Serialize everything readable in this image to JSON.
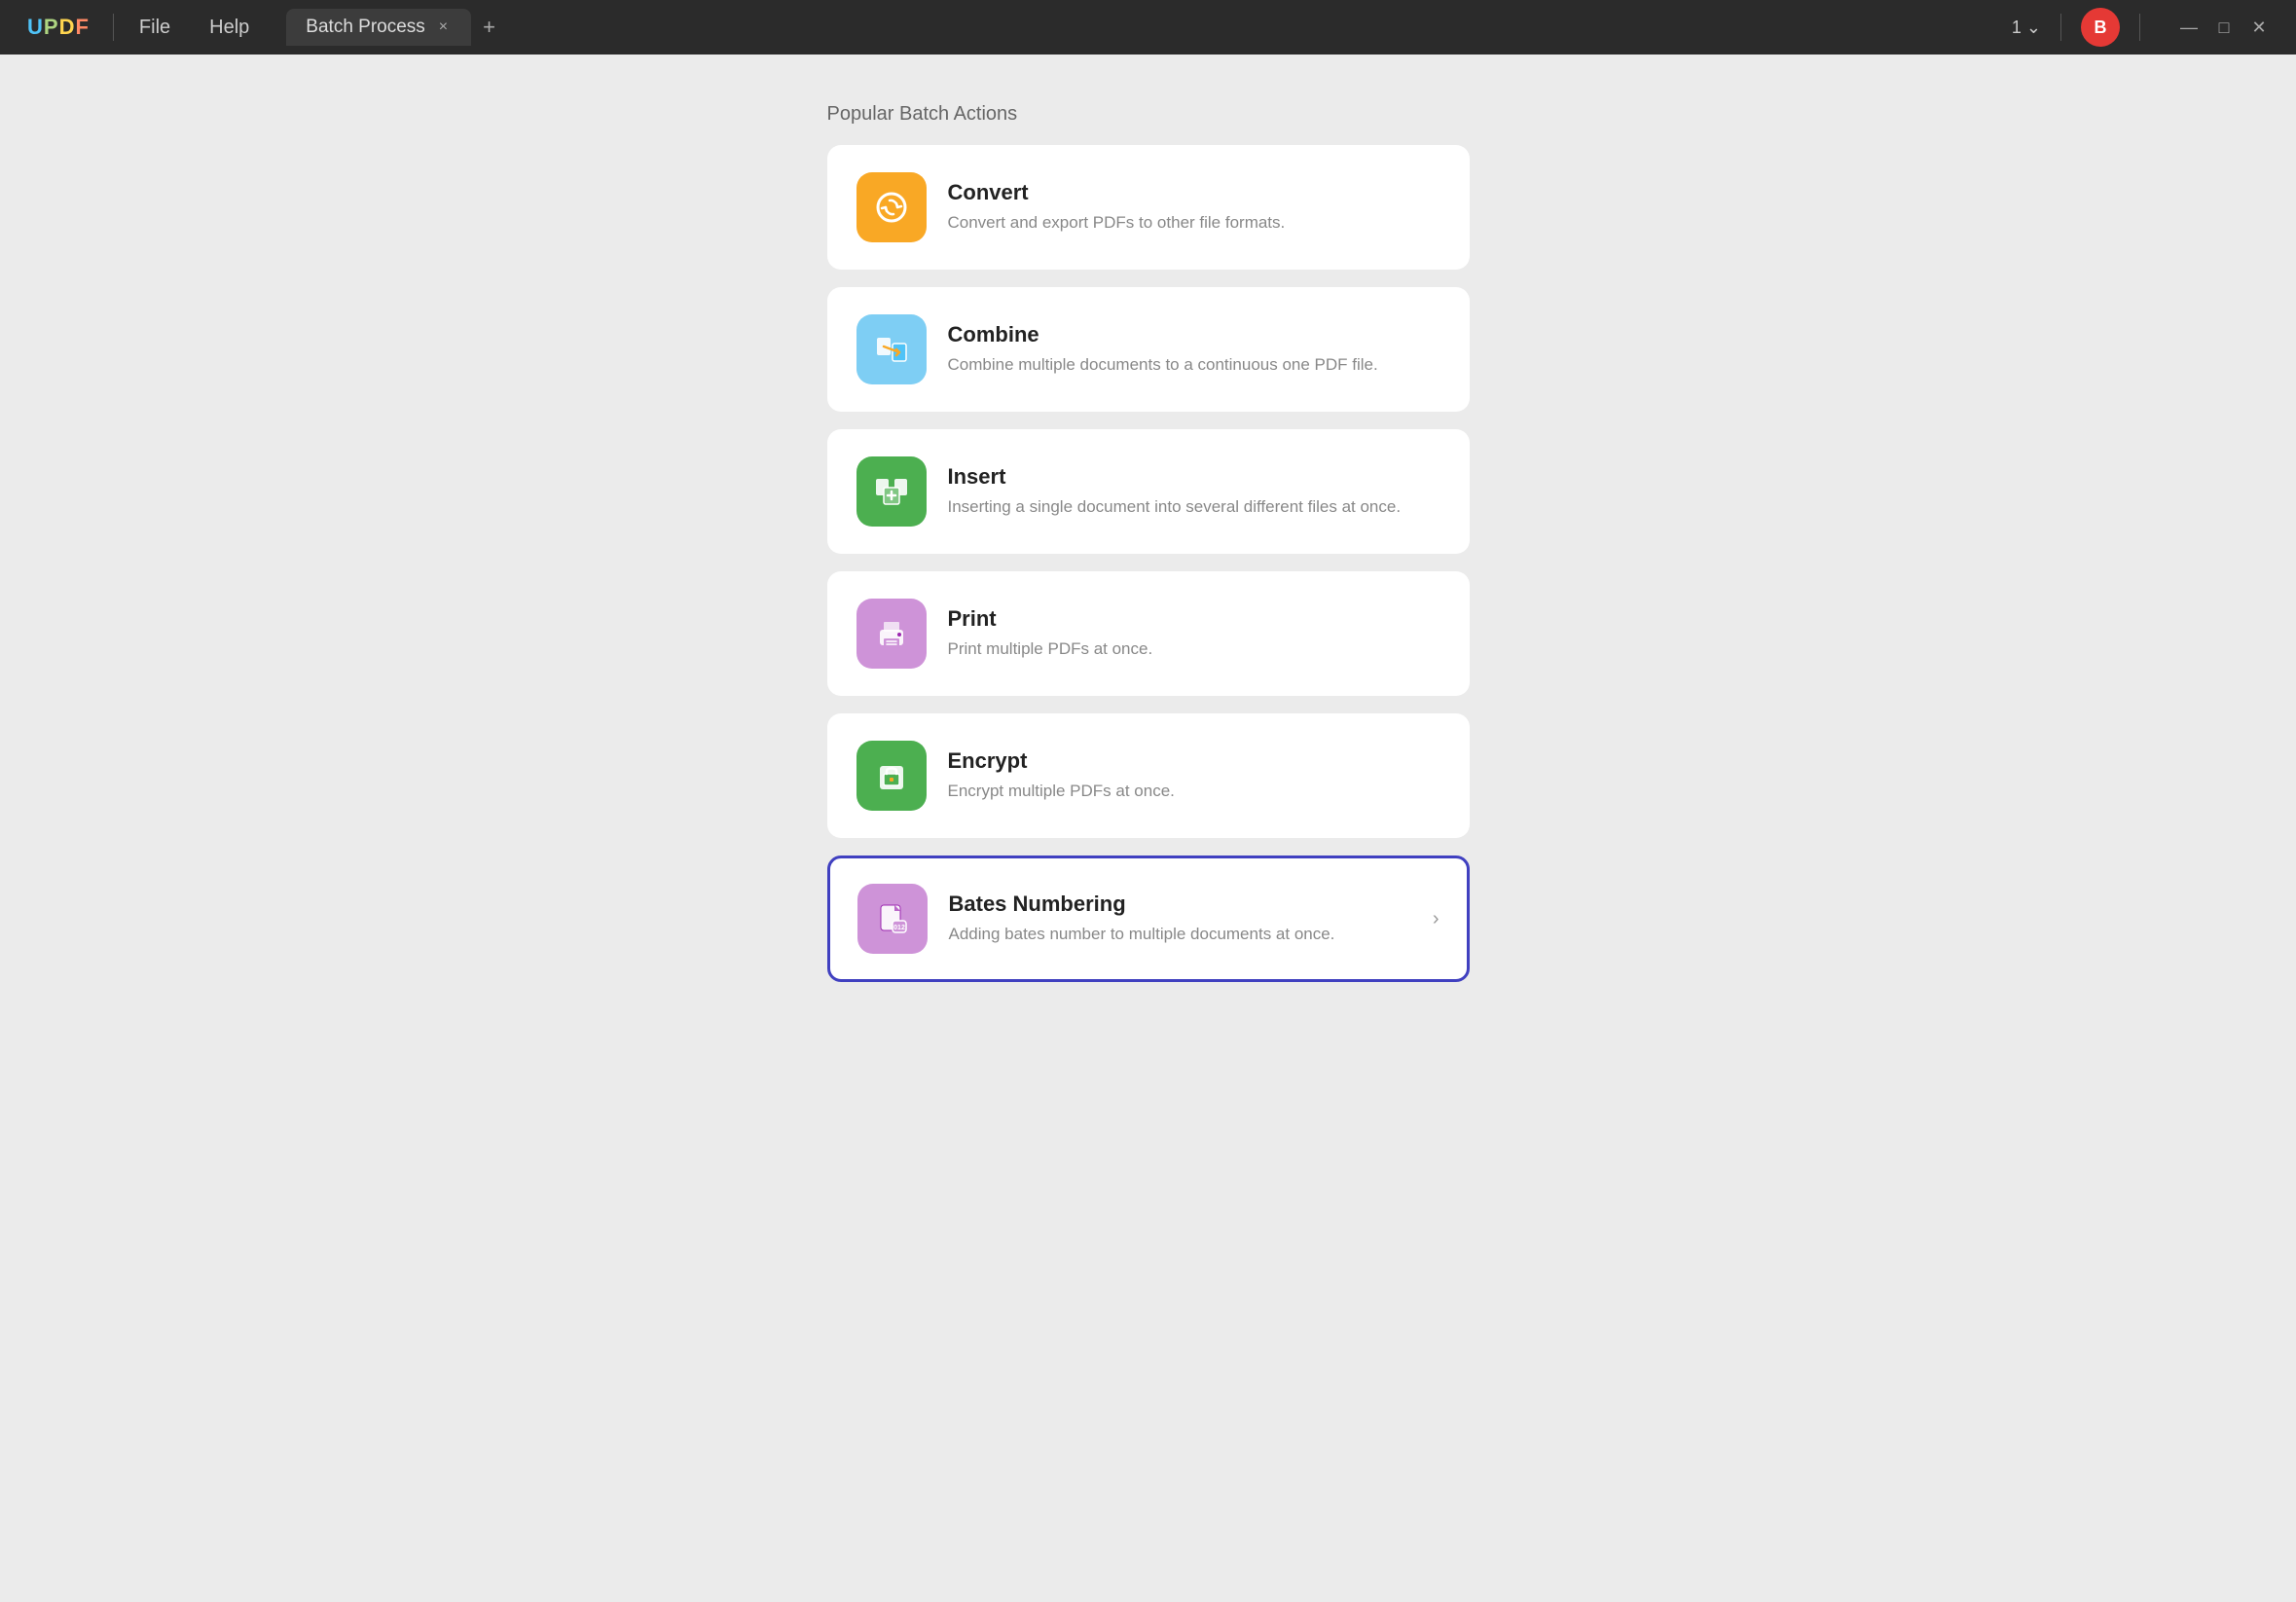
{
  "app": {
    "logo": "UPDF",
    "logo_colors": [
      "U",
      "P",
      "D",
      "F"
    ]
  },
  "titlebar": {
    "menu_items": [
      "File",
      "Help"
    ],
    "tab_title": "Batch Process",
    "tab_close_symbol": "×",
    "tab_new_symbol": "+",
    "window_count": "1",
    "window_count_arrow": "⌄",
    "user_initial": "B",
    "minimize": "—",
    "maximize": "□",
    "close": "✕"
  },
  "main": {
    "section_title": "Popular Batch Actions",
    "actions": [
      {
        "id": "convert",
        "title": "Convert",
        "desc": "Convert and export PDFs to other file formats.",
        "icon_color": "yellow",
        "selected": false
      },
      {
        "id": "combine",
        "title": "Combine",
        "desc": "Combine multiple documents to a continuous one PDF file.",
        "icon_color": "blue-light",
        "selected": false
      },
      {
        "id": "insert",
        "title": "Insert",
        "desc": "Inserting a single document into several different files at once.",
        "icon_color": "green",
        "selected": false
      },
      {
        "id": "print",
        "title": "Print",
        "desc": "Print multiple PDFs at once.",
        "icon_color": "purple-light",
        "selected": false
      },
      {
        "id": "encrypt",
        "title": "Encrypt",
        "desc": "Encrypt multiple PDFs at once.",
        "icon_color": "green",
        "selected": false
      },
      {
        "id": "bates",
        "title": "Bates Numbering",
        "desc": "Adding bates number to multiple documents at once.",
        "icon_color": "purple2",
        "selected": true
      }
    ]
  }
}
